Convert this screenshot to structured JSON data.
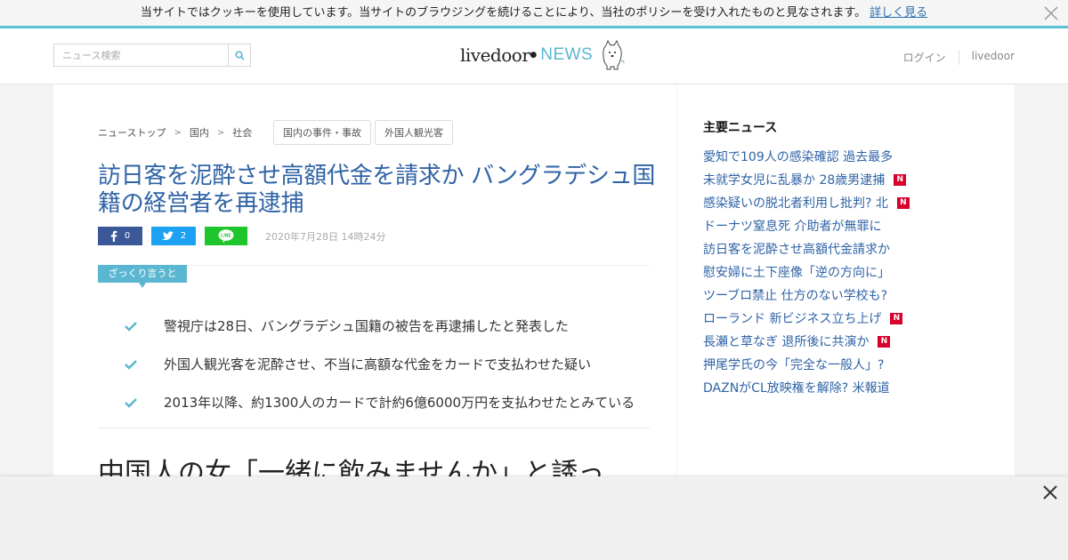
{
  "cookie": {
    "message": "当サイトではクッキーを使用しています。当サイトのブラウジングを続けることにより、当社のポリシーを受け入れたものと見なされます。",
    "link": "詳しく見る",
    "close_icon": "close-icon"
  },
  "header": {
    "search_placeholder": "ニュース検索",
    "logo_livedoor": "livedoor",
    "logo_news": "NEWS",
    "links": [
      "ログイン",
      "livedoor"
    ]
  },
  "article": {
    "breadcrumb": [
      "ニューストップ",
      "国内",
      "社会"
    ],
    "tags": [
      "国内の事件・事故",
      "外国人観光客"
    ],
    "title": "訪日客を泥酔させ高額代金を請求か バングラデシュ国籍の経営者を再逮捕",
    "share": {
      "facebook_count": "0",
      "twitter_count": "2"
    },
    "date": "2020年7月28日 14時24分",
    "summary_label": "ざっくり言うと",
    "points": [
      "警視庁は28日、バングラデシュ国籍の被告を再逮捕したと発表した",
      "外国人観光客を泥酔させ、不当に高額な代金をカードで支払わせた疑い",
      "2013年以降、約1300人のカードで計約6億6000万円を支払わせたとみている"
    ],
    "subhead": "中国人の女「一緒に飲みませんか」と誘っ"
  },
  "sidebar": {
    "title": "主要ニュース",
    "news": [
      {
        "text": "愛知で109人の感染確認 過去最多",
        "new": false
      },
      {
        "text": "未就学女児に乱暴か 28歳男逮捕",
        "new": true
      },
      {
        "text": "感染疑いの脱北者利用し批判? 北",
        "new": true
      },
      {
        "text": "ドーナツ窒息死 介助者が無罪に",
        "new": false
      },
      {
        "text": "訪日客を泥酔させ高額代金請求か",
        "new": false
      },
      {
        "text": "慰安婦に土下座像「逆の方向に」",
        "new": false
      },
      {
        "text": "ツーブロ禁止 仕方のない学校も?",
        "new": false
      },
      {
        "text": "ローランド 新ビジネス立ち上げ",
        "new": true
      },
      {
        "text": "長瀬と草なぎ 退所後に共演か",
        "new": true
      },
      {
        "text": "押尾学氏の今「完全な一般人」?",
        "new": false
      },
      {
        "text": "DAZNがCL放映権を解除? 米報道",
        "new": false
      }
    ],
    "new_badge": "N"
  },
  "colors": {
    "accent": "#5bb7d1",
    "link": "#2f63a6",
    "badge": "#d9002c"
  }
}
